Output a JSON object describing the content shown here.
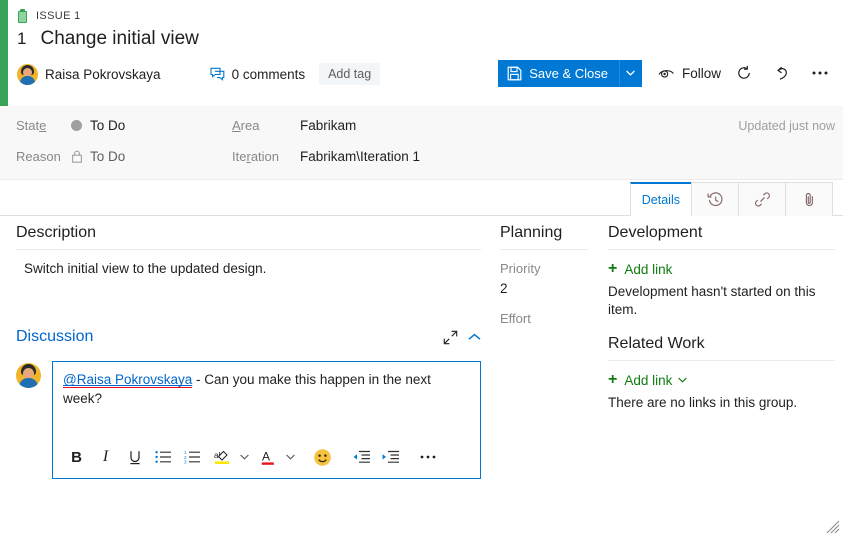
{
  "window": {
    "expand_icon": "expand-diagonal-icon",
    "close_icon": "close-icon"
  },
  "header": {
    "type_label": "ISSUE 1",
    "type_icon": "issue-icon",
    "work_item_id": "1",
    "title": "Change initial view",
    "author": "Raisa Pokrovskaya",
    "avatar_icon": "user-avatar",
    "comments_label": "0 comments",
    "comments_icon": "comment-bubble-icon",
    "add_tag_label": "Add tag",
    "save_close_label": "Save & Close",
    "save_icon": "save-disk-icon",
    "split_caret_icon": "chevron-down-icon",
    "follow_label": "Follow",
    "follow_icon": "eye-icon",
    "refresh_icon": "refresh-icon",
    "undo_icon": "undo-icon",
    "more_icon": "more-ellipsis-icon",
    "accent_color": "#3aa357",
    "primary_color": "#0078d4"
  },
  "fields": {
    "state": {
      "label": "State",
      "label_prefix": "Stat",
      "label_key": "e",
      "value": "To Do",
      "dot_color": "#a19f9d"
    },
    "reason": {
      "label": "Reason",
      "value": "To Do",
      "icon": "lock-icon"
    },
    "area": {
      "label": "Area",
      "label_prefix": "",
      "label_key": "A",
      "label_suffix": "rea",
      "value": "Fabrikam"
    },
    "iteration": {
      "label": "Iteration",
      "label_prefix": "Ite",
      "label_key": "r",
      "label_suffix": "ation",
      "value": "Fabrikam\\Iteration 1"
    },
    "updated_note": "Updated just now"
  },
  "tabs": [
    {
      "label": "Details",
      "icon": "",
      "active": true
    },
    {
      "label": "",
      "icon": "history-clock-icon",
      "active": false
    },
    {
      "label": "",
      "icon": "link-icon",
      "active": false
    },
    {
      "label": "",
      "icon": "attachment-paperclip-icon",
      "active": false
    }
  ],
  "description": {
    "heading": "Description",
    "text": "Switch initial view to the updated design."
  },
  "discussion": {
    "heading": "Discussion",
    "expand_icon": "expand-diagonal-icon",
    "collapse_icon": "chevron-up-icon",
    "comment": {
      "avatar_icon": "user-avatar",
      "mention": "@Raisa Pokrovskaya",
      "body": " - Can you make this happen in the next week?"
    },
    "toolbar": [
      {
        "name": "bold-icon",
        "glyph": "B"
      },
      {
        "name": "italic-icon",
        "glyph": "I"
      },
      {
        "name": "underline-icon",
        "glyph": "U"
      },
      {
        "name": "bulleted-list-icon",
        "glyph": ""
      },
      {
        "name": "numbered-list-icon",
        "glyph": ""
      },
      {
        "name": "highlight-color-icon",
        "glyph": ""
      },
      {
        "name": "font-color-icon",
        "glyph": "A"
      },
      {
        "name": "emoji-icon",
        "glyph": ""
      },
      {
        "name": "decrease-indent-icon",
        "glyph": ""
      },
      {
        "name": "increase-indent-icon",
        "glyph": ""
      },
      {
        "name": "more-ellipsis-icon",
        "glyph": ""
      }
    ]
  },
  "planning": {
    "heading": "Planning",
    "priority_label": "Priority",
    "priority_value": "2",
    "effort_label": "Effort",
    "effort_value": ""
  },
  "development": {
    "heading": "Development",
    "add_link_label": "Add link",
    "note": "Development hasn't started on this item."
  },
  "related_work": {
    "heading": "Related Work",
    "add_link_label": "Add link",
    "note": "There are no links in this group."
  },
  "resize_grip": "resize-grip-icon"
}
